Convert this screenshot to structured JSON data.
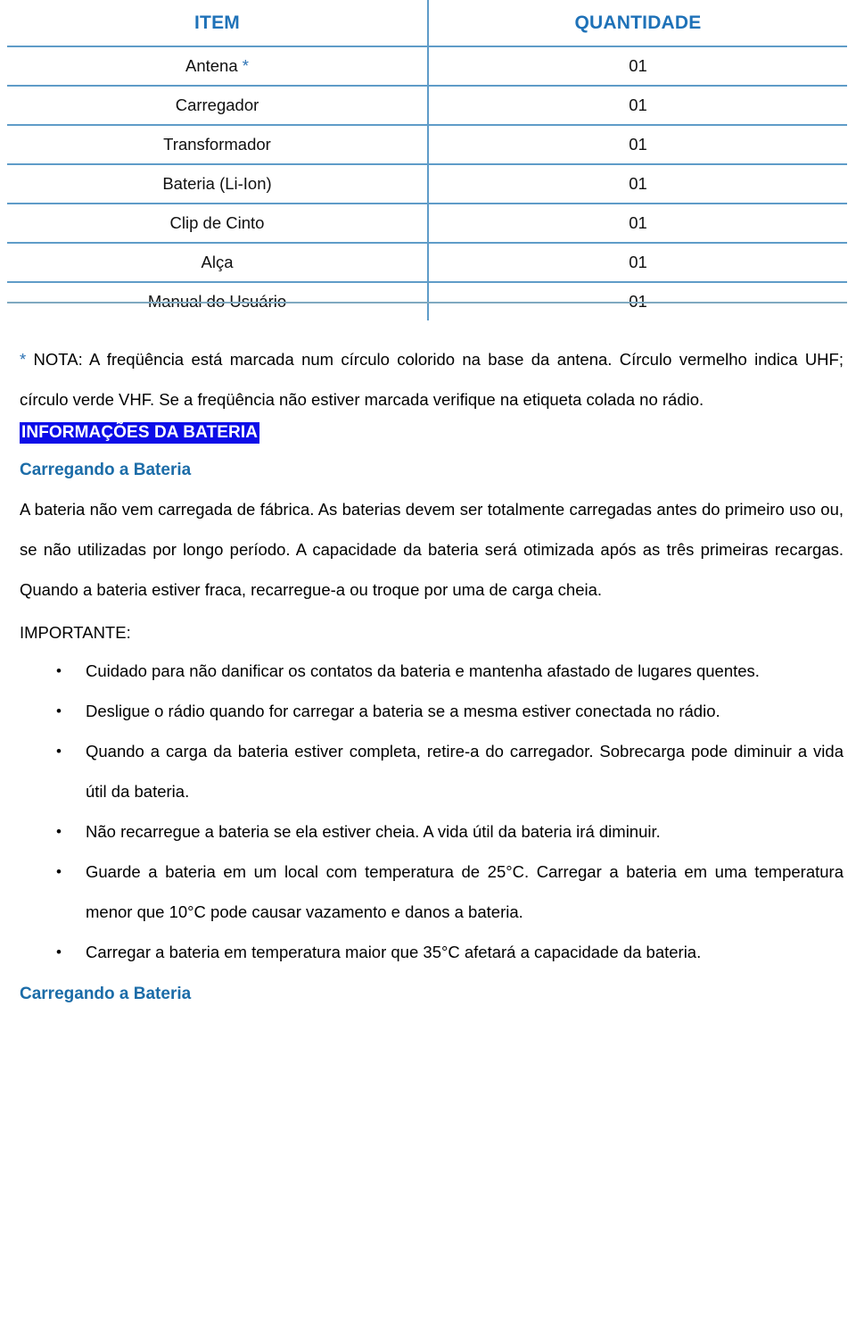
{
  "colors": {
    "table_header_blue": "#1F72B8",
    "table_rule_blue": "#5F9CC8",
    "highlight_blue": "#0D0DE8",
    "heading_blue": "#1B6CA8",
    "asterisk_blue": "#2E74B5",
    "body_black": "#000000"
  },
  "table": {
    "headers": [
      "ITEM",
      "QUANTIDADE"
    ],
    "rows": [
      {
        "item": "Antena ",
        "item_mark": "*",
        "qty": "01"
      },
      {
        "item": "Carregador",
        "item_mark": "",
        "qty": "01"
      },
      {
        "item": "Transformador",
        "item_mark": "",
        "qty": "01"
      },
      {
        "item": "Bateria (Li-Ion)",
        "item_mark": "",
        "qty": "01"
      },
      {
        "item": "Clip de Cinto",
        "item_mark": "",
        "qty": "01"
      },
      {
        "item": "Alça",
        "item_mark": "",
        "qty": "01"
      },
      {
        "item": "Manual do Usuário",
        "item_mark": "",
        "qty": "01"
      }
    ]
  },
  "note": {
    "marker": "*",
    "text": " NOTA: A freqüência está marcada num círculo colorido na base da antena. Círculo vermelho indica UHF; círculo verde VHF. Se a freqüência não estiver marcada verifique na etiqueta colada no rádio."
  },
  "section": {
    "title": "INFORMAÇÕES DA BATERIA",
    "subtitle": "Carregando a Bateria",
    "paragraph": "A bateria não vem carregada de fábrica. As baterias devem ser totalmente carregadas antes do primeiro uso ou, se não utilizadas por longo período. A capacidade da bateria será otimizada após as três primeiras recargas. Quando a bateria estiver fraca, recarregue-a ou troque por uma de carga cheia.",
    "important_label": "IMPORTANTE:",
    "bullet_glyph": "•",
    "bullets": [
      "Cuidado para não danificar os contatos da bateria e mantenha afastado de lugares quentes.",
      "Desligue o rádio quando for carregar a bateria se a mesma estiver conectada no rádio.",
      "Quando a carga da bateria estiver completa, retire-a do carregador. Sobrecarga pode diminuir a vida útil da bateria.",
      "Não recarregue a bateria se ela estiver cheia. A vida útil da bateria irá diminuir.",
      "Guarde a bateria em um local com temperatura de 25°C. Carregar a bateria em uma temperatura menor que 10°C pode causar vazamento e danos a bateria.",
      "Carregar a bateria em temperatura maior que 35°C afetará a capacidade da bateria."
    ],
    "footer_subtitle": "Carregando a Bateria"
  }
}
